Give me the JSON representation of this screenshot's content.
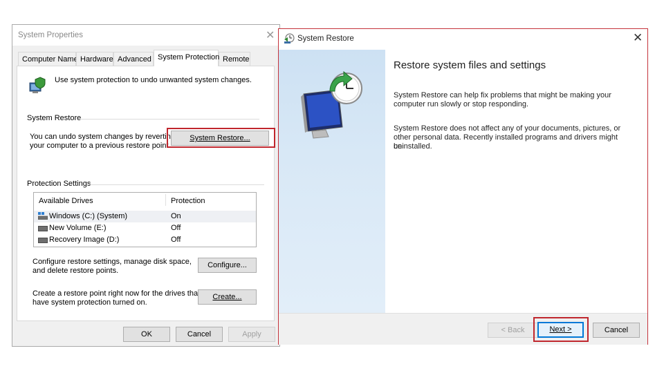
{
  "system_properties": {
    "title": "System Properties",
    "close_glyph": "✕",
    "tabs": [
      "Computer Name",
      "Hardware",
      "Advanced",
      "System Protection",
      "Remote"
    ],
    "active_tab": "System Protection",
    "intro_text": "Use system protection to undo unwanted system changes.",
    "restore_group": {
      "label": "System Restore",
      "text_line1": "You can undo system changes by reverting",
      "text_line2": "your computer to a previous restore point.",
      "button": "System Restore..."
    },
    "protection_group": {
      "label": "Protection Settings",
      "columns": [
        "Available Drives",
        "Protection"
      ],
      "drives": [
        {
          "name": "Windows (C:) (System)",
          "protection": "On",
          "icon": "system-drive-icon"
        },
        {
          "name": "New Volume (E:)",
          "protection": "Off",
          "icon": "drive-icon"
        },
        {
          "name": "Recovery Image (D:)",
          "protection": "Off",
          "icon": "drive-icon"
        }
      ]
    },
    "configure_text_line1": "Configure restore settings, manage disk space,",
    "configure_text_line2": "and delete restore points.",
    "configure_button": "Configure...",
    "create_text_line1": "Create a restore point right now for the drives that",
    "create_text_line2": "have system protection turned on.",
    "create_button": "Create...",
    "ok_button": "OK",
    "cancel_button": "Cancel",
    "apply_button": "Apply"
  },
  "system_restore": {
    "title": "System Restore",
    "close_glyph": "✕",
    "heading": "Restore system files and settings",
    "para1_line1": "System Restore can help fix problems that might be making your",
    "para1_line2": "computer run slowly or stop responding.",
    "para2_line1": "System Restore does not affect any of your documents, pictures, or",
    "para2_line2": "other personal data. Recently installed programs and drivers might be",
    "para2_line3": "uninstalled.",
    "back_button": "< Back",
    "next_button": "Next >",
    "cancel_button": "Cancel"
  },
  "colors": {
    "highlight_red": "#c0262d",
    "side_panel_blue": "#d4e5f5",
    "focus_blue": "#0078d7"
  }
}
